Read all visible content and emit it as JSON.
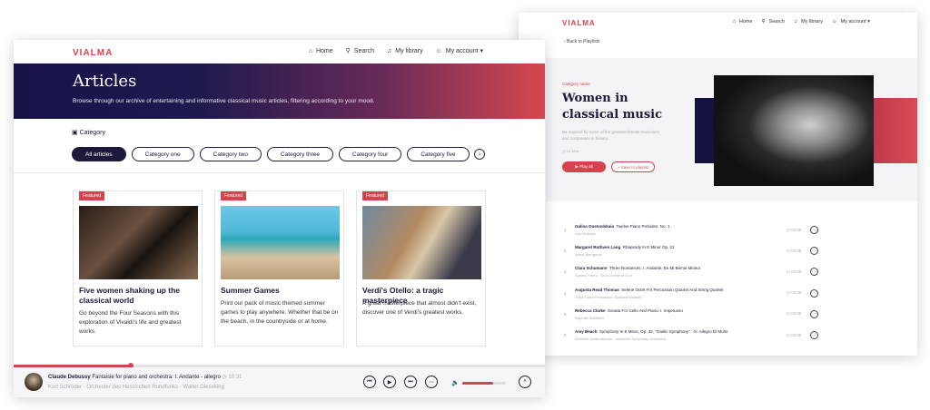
{
  "playlist_page": {
    "logo": "VIALMA",
    "nav": {
      "home": "Home",
      "search": "Search",
      "library": "My library",
      "account": "My account ▾"
    },
    "back": "‹  Back to Playlists",
    "category": "Category name",
    "title": "Women in classical music",
    "description": "Be inspired by some of the greatest female musicians and composers in history.",
    "length": "◷ 1h 38m",
    "play_all": "▶  Play all",
    "save": "+  Save to playlist",
    "tracks": [
      {
        "n": "1",
        "composer": "Galina Oustvolskaia",
        "work": "Twelve Piano Preludes: No. 1",
        "performer": "Ivan Sokolov",
        "duration": "◷ 02:05"
      },
      {
        "n": "2",
        "composer": "Margaret Ruthven Lang",
        "work": "Rhapsody In E Minor Op. 21",
        "performer": "Artem Belogurov",
        "duration": "◷ 02:05"
      },
      {
        "n": "3",
        "composer": "Clara Schumann",
        "work": "Three Romances: I. Andante, En Mi Bémol Mineur",
        "performer": "Sydney Fierro · Duo Goethe in Gun",
        "duration": "◷ 02:05"
      },
      {
        "n": "4",
        "composer": "Augusta Read Thomas",
        "work": "Selene Octet For Percussion Quartet And String Quartet",
        "performer": "Third Coast Percussion, Spektral Quartet",
        "duration": "◷ 02:05"
      },
      {
        "n": "5",
        "composer": "Rebecca Clarke",
        "work": "Sonata For Cello And Piano: I. Impetuoso",
        "performer": "Raphael Wallfisch",
        "duration": "◷ 02:05"
      },
      {
        "n": "6",
        "composer": "Amy Beach",
        "work": "Symphony In E Minor, Op. 32, \"Gaelic Symphony\" : IV. Allegro Di Molto",
        "performer": "Kenneth Schermerhorn · Nashville Symphony Orchestra",
        "duration": "◷ 02:05"
      }
    ]
  },
  "articles_page": {
    "logo": "VIALMA",
    "nav": {
      "home": "Home",
      "search": "Search",
      "library": "My library",
      "account": "My account ▾"
    },
    "title": "Articles",
    "subtitle": "Browse through our archive of entertaining and informative classical music articles, filtering according to your mood.",
    "category_label": "Category",
    "chips": [
      "All articles",
      "Category one",
      "Category two",
      "Category three",
      "Category four",
      "Category five"
    ],
    "cards": [
      {
        "badge": "Featured",
        "title": "Five women shaking up the classical world",
        "desc": "Go beyond the Four Seasons with this exploration of Vivaldi's life and greatest works."
      },
      {
        "badge": "Featured",
        "title": "Summer Games",
        "desc": "Print our pack of music themed summer games to play anywhere. Whether that be on the beach, in the countryside or at home."
      },
      {
        "badge": "Featured",
        "title": "Verdi's Otello: a tragic masterpiece",
        "desc": "A great masterpiece that almost didn't exist, discover one of Verdi's greatest works."
      }
    ],
    "player": {
      "composer": "Claude Debussy",
      "work": "Fantaisie for piano and orchestra: I. Andante - allegro",
      "duration": "◷ 10:31",
      "performers": "Kurt Schröder · Orchester des Hessischen Rundfunks · Walter Gieseking",
      "progress": 0.22,
      "volume": 0.7
    }
  }
}
